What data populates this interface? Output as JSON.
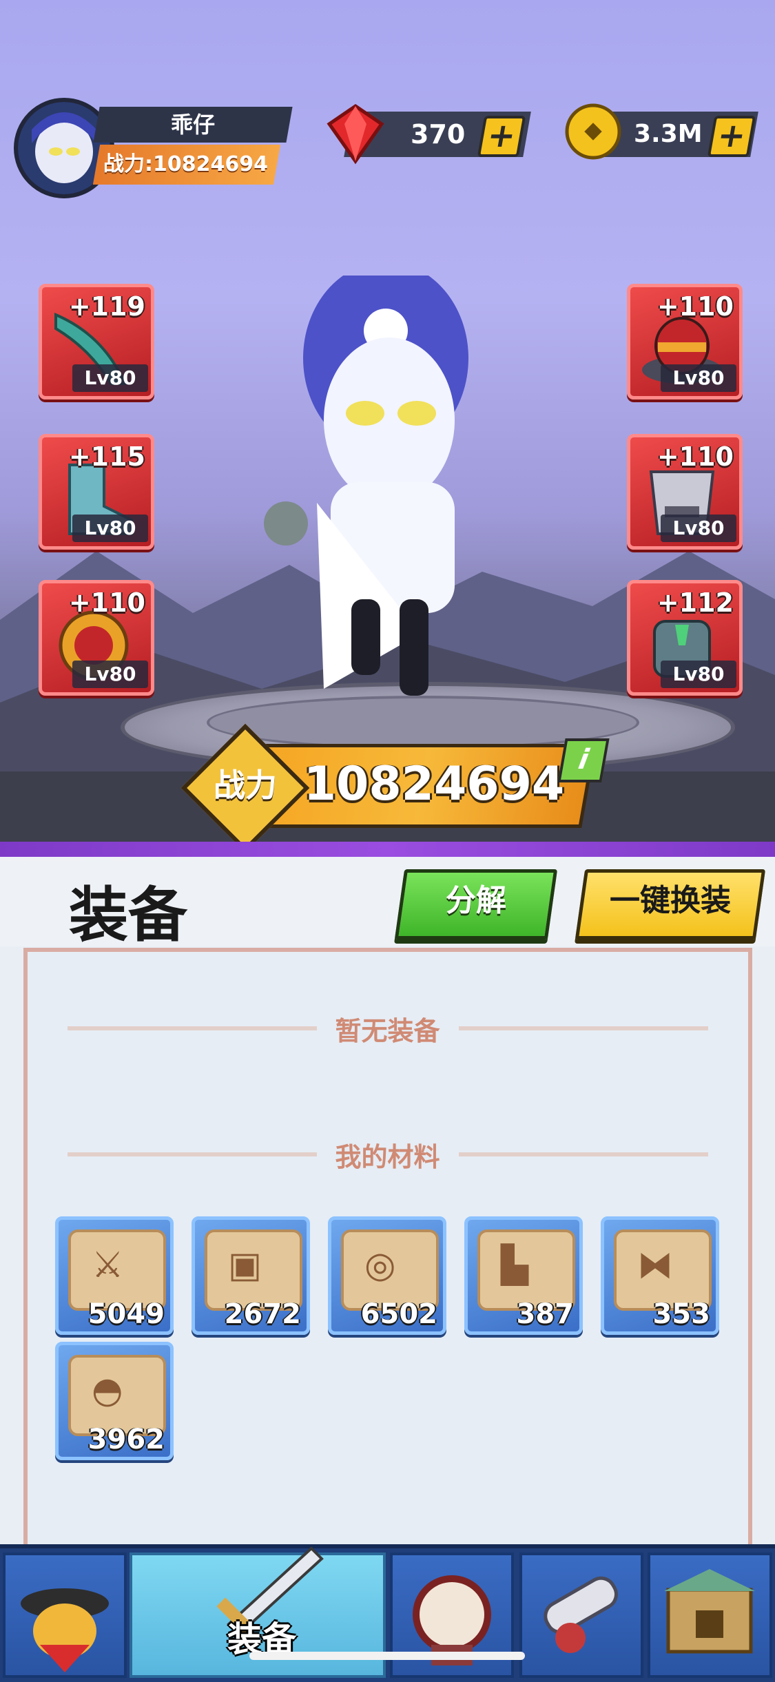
{
  "player": {
    "name": "乖仔",
    "power_label": "战力:10824694"
  },
  "currency": {
    "gems": "370",
    "coins": "3.3M"
  },
  "equipment_slots": [
    {
      "plus": "+119",
      "level": "Lv80",
      "icon": "blade-icon"
    },
    {
      "plus": "+115",
      "level": "Lv80",
      "icon": "boots-icon"
    },
    {
      "plus": "+110",
      "level": "Lv80",
      "icon": "amulet-icon"
    },
    {
      "plus": "+110",
      "level": "Lv80",
      "icon": "hat-icon"
    },
    {
      "plus": "+110",
      "level": "Lv80",
      "icon": "armor-icon"
    },
    {
      "plus": "+112",
      "level": "Lv80",
      "icon": "gauntlet-icon"
    }
  ],
  "power_banner": {
    "label": "战力",
    "value": "10824694",
    "info": "i"
  },
  "panel": {
    "title": "装备",
    "decompose_label": "分解",
    "quick_equip_label": "一键换装",
    "empty_label": "暂无装备",
    "materials_label": "我的材料"
  },
  "materials": [
    {
      "count": "5049",
      "icon": "sword-scroll-icon"
    },
    {
      "count": "2672",
      "icon": "armor-scroll-icon"
    },
    {
      "count": "6502",
      "icon": "ring-scroll-icon"
    },
    {
      "count": "387",
      "icon": "boot-scroll-icon"
    },
    {
      "count": "353",
      "icon": "belt-scroll-icon"
    },
    {
      "count": "3962",
      "icon": "hat-scroll-icon"
    }
  ],
  "nav": {
    "active_label": "装备",
    "tabs": [
      "hero-tab",
      "equipment-tab",
      "drum-tab",
      "cannon-tab",
      "fortress-tab"
    ]
  },
  "colors": {
    "slot_red": "#d8303a",
    "material_blue": "#4a82d8",
    "power_orange": "#f5a623",
    "divider_purple": "#8a44d4"
  }
}
